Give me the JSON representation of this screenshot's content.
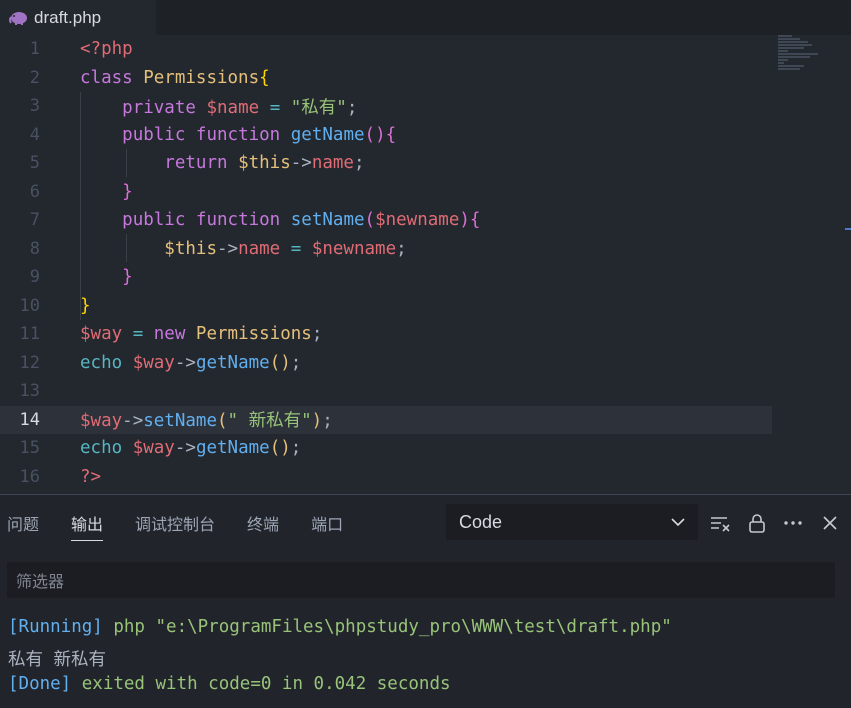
{
  "tab": {
    "filename": "draft.php",
    "icon": "php-elephant-icon"
  },
  "editor": {
    "current_line": 14,
    "line_numbers": [
      "1",
      "2",
      "3",
      "4",
      "5",
      "6",
      "7",
      "8",
      "9",
      "10",
      "11",
      "12",
      "13",
      "14",
      "15",
      "16"
    ],
    "tokens": {
      "l1_open": "<?php",
      "l2_class": "class",
      "l2_name": "Permissions",
      "l2_brace": "{",
      "l3_private": "private",
      "l3_var": "$name",
      "l3_eq": " = ",
      "l3_str": "\"私有\"",
      "l3_semi": ";",
      "l4_public": "public",
      "l4_function": "function",
      "l4_name": "getName",
      "l4_paren": "()",
      "l4_brace": "{",
      "l5_return": "return",
      "l5_this": "$this",
      "l5_arrow": "->",
      "l5_prop": "name",
      "l5_semi": ";",
      "l6_brace": "}",
      "l7_public": "public",
      "l7_function": "function",
      "l7_name": "setName",
      "l7_popen": "(",
      "l7_arg": "$newname",
      "l7_pclose": ")",
      "l7_brace": "{",
      "l8_this": "$this",
      "l8_arrow": "->",
      "l8_prop": "name",
      "l8_eq": " = ",
      "l8_var": "$newname",
      "l8_semi": ";",
      "l9_brace": "}",
      "l10_brace": "}",
      "l11_var": "$way",
      "l11_eq": " = ",
      "l11_new": "new",
      "l11_cls": "Permissions",
      "l11_semi": ";",
      "l12_echo": "echo",
      "l12_var": "$way",
      "l12_arrow": "->",
      "l12_fn": "getName",
      "l12_paren": "()",
      "l12_semi": ";",
      "l14_var": "$way",
      "l14_arrow": "->",
      "l14_fn": "setName",
      "l14_popen": "(",
      "l14_str": "\" 新私有\"",
      "l14_pclose": ")",
      "l14_semi": ";",
      "l15_echo": "echo",
      "l15_var": "$way",
      "l15_arrow": "->",
      "l15_fn": "getName",
      "l15_paren": "()",
      "l15_semi": ";",
      "l16_close": "?>"
    }
  },
  "panel": {
    "tabs": [
      "问题",
      "输出",
      "调试控制台",
      "终端",
      "端口"
    ],
    "active_tab": "输出",
    "output_channel": "Code",
    "filter_placeholder": "筛选器",
    "output": {
      "l1_tag": "[Running]",
      "l1_text": " php \"e:\\ProgramFiles\\phpstudy_pro\\WWW\\test\\draft.php\"",
      "l2_text": "私有 新私有",
      "l3_tag": "[Done]",
      "l3_text": " exited with code=0 in 0.042 seconds"
    }
  }
}
